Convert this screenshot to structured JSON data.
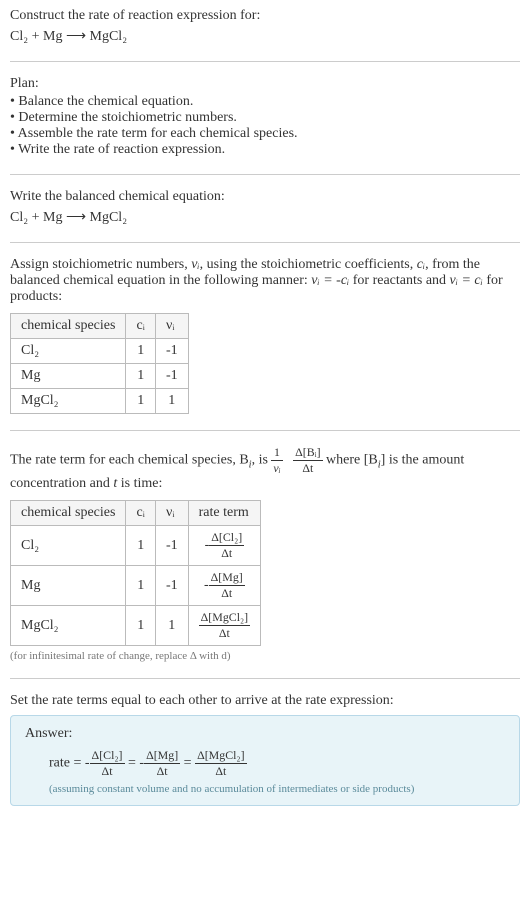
{
  "header": {
    "title": "Construct the rate of reaction expression for:",
    "equation": "Cl₂ + Mg ⟶ MgCl₂"
  },
  "plan": {
    "label": "Plan:",
    "items": [
      "Balance the chemical equation.",
      "Determine the stoichiometric numbers.",
      "Assemble the rate term for each chemical species.",
      "Write the rate of reaction expression."
    ]
  },
  "balanced": {
    "label": "Write the balanced chemical equation:",
    "equation": "Cl₂ + Mg ⟶ MgCl₂"
  },
  "assign": {
    "text_before": "Assign stoichiometric numbers, ",
    "nu_i": "νᵢ",
    "text_mid1": ", using the stoichiometric coefficients, ",
    "c_i": "cᵢ",
    "text_mid2": ", from the balanced chemical equation in the following manner: ",
    "formula1": "νᵢ = -cᵢ",
    "text_mid3": " for reactants and ",
    "formula2": "νᵢ = cᵢ",
    "text_after": " for products:",
    "table": {
      "headers": [
        "chemical species",
        "cᵢ",
        "νᵢ"
      ],
      "rows": [
        {
          "species": "Cl₂",
          "c": "1",
          "nu": "-1"
        },
        {
          "species": "Mg",
          "c": "1",
          "nu": "-1"
        },
        {
          "species": "MgCl₂",
          "c": "1",
          "nu": "1"
        }
      ]
    }
  },
  "rate_term": {
    "text1": "The rate term for each chemical species, B",
    "sub_i": "i",
    "text2": ", is ",
    "frac1_num": "1",
    "frac1_den": "νᵢ",
    "frac2_num": "Δ[Bᵢ]",
    "frac2_den": "Δt",
    "text3": " where [B",
    "text4": "] is the amount concentration and ",
    "t_var": "t",
    "text5": " is time:",
    "table": {
      "headers": [
        "chemical species",
        "cᵢ",
        "νᵢ",
        "rate term"
      ],
      "rows": [
        {
          "species": "Cl₂",
          "c": "1",
          "nu": "-1",
          "rate_num": "Δ[Cl₂]",
          "rate_den": "Δt",
          "neg": "-"
        },
        {
          "species": "Mg",
          "c": "1",
          "nu": "-1",
          "rate_num": "Δ[Mg]",
          "rate_den": "Δt",
          "neg": "-"
        },
        {
          "species": "MgCl₂",
          "c": "1",
          "nu": "1",
          "rate_num": "Δ[MgCl₂]",
          "rate_den": "Δt",
          "neg": ""
        }
      ]
    },
    "note": "(for infinitesimal rate of change, replace Δ with d)"
  },
  "set_equal": {
    "text": "Set the rate terms equal to each other to arrive at the rate expression:"
  },
  "answer": {
    "label": "Answer:",
    "rate_prefix": "rate = ",
    "term1_neg": "-",
    "term1_num": "Δ[Cl₂]",
    "term1_den": "Δt",
    "eq1": " = ",
    "term2_neg": "-",
    "term2_num": "Δ[Mg]",
    "term2_den": "Δt",
    "eq2": " = ",
    "term3_num": "Δ[MgCl₂]",
    "term3_den": "Δt",
    "note": "(assuming constant volume and no accumulation of intermediates or side products)"
  }
}
